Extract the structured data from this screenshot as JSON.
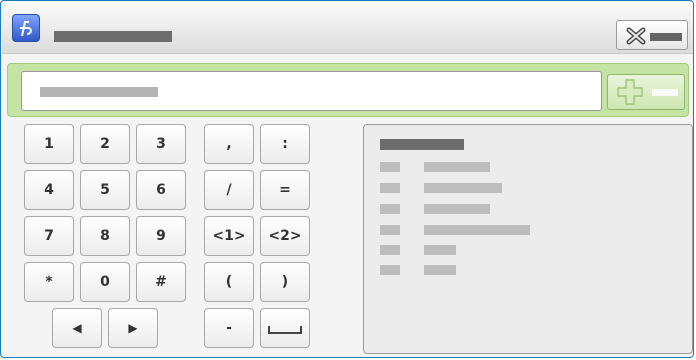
{
  "window": {
    "title": ""
  },
  "header": {
    "app_icon": "app-logo-icon",
    "close_icon": "close-x-icon"
  },
  "entry": {
    "value": "",
    "add_icon": "plus-icon"
  },
  "keypad": {
    "digits": [
      "1",
      "2",
      "3",
      "4",
      "5",
      "6",
      "7",
      "8",
      "9",
      "*",
      "0",
      "#"
    ],
    "symbols": [
      ",",
      ":",
      "/",
      "=",
      "<1>",
      "<2>",
      "(",
      ")",
      "-"
    ],
    "arrows": {
      "left": "◀",
      "right": "▶"
    },
    "space_icon": "space-bar-icon"
  },
  "help_panel": {
    "rows": 6
  }
}
